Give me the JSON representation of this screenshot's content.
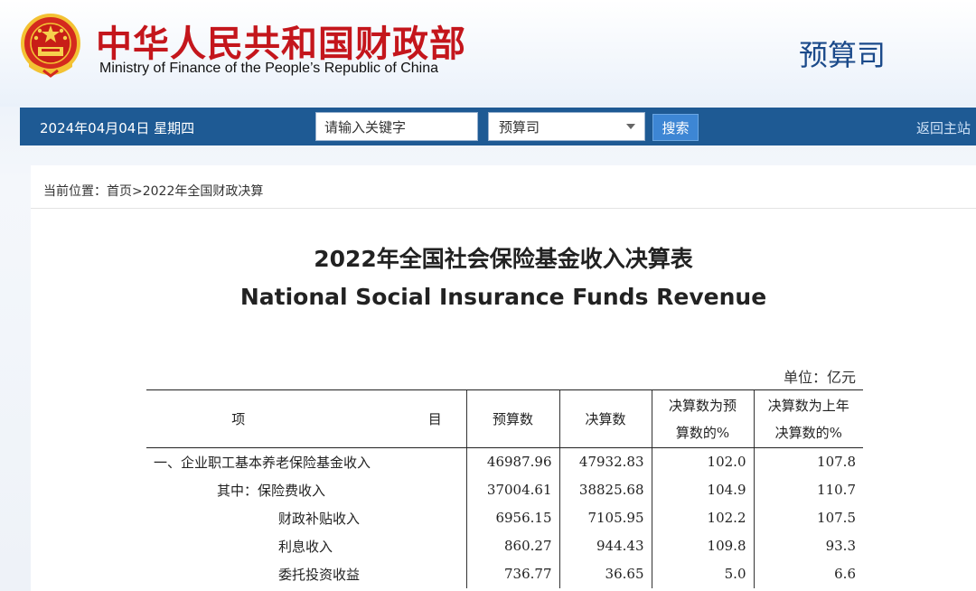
{
  "header": {
    "brand_cn": "中华人民共和国财政部",
    "brand_en": "Ministry of Finance of the People’s Republic of China",
    "department": "预算司"
  },
  "navbar": {
    "date": "2024年04月04日  星期四",
    "search_placeholder": "请输入关键字",
    "scope_selected": "预算司",
    "search_button": "搜索",
    "home_link": "返回主站"
  },
  "breadcrumb": "当前位置：首页>2022年全国财政决算",
  "report": {
    "title_cn": "2022年全国社会保险基金收入决算表",
    "title_en": "National Social Insurance Funds Revenue",
    "unit": "单位：亿元",
    "columns": {
      "item_a": "项",
      "item_b": "目",
      "budget": "预算数",
      "final": "决算数",
      "pct_budget_1": "决算数为预",
      "pct_budget_2": "算数的%",
      "pct_prev_1": "决算数为上年",
      "pct_prev_2": "决算数的%"
    },
    "rows": [
      {
        "item": "一、企业职工基本养老保险基金收入",
        "budget": "46987.96",
        "final": "47932.83",
        "pct_budget": "102.0",
        "pct_prev": "107.8"
      },
      {
        "item": "其中：保险费收入",
        "budget": "37004.61",
        "final": "38825.68",
        "pct_budget": "104.9",
        "pct_prev": "110.7"
      },
      {
        "item": "财政补贴收入",
        "budget": "6956.15",
        "final": "7105.95",
        "pct_budget": "102.2",
        "pct_prev": "107.5"
      },
      {
        "item": "利息收入",
        "budget": "860.27",
        "final": "944.43",
        "pct_budget": "109.8",
        "pct_prev": "93.3"
      },
      {
        "item": "委托投资收益",
        "budget": "736.77",
        "final": "36.65",
        "pct_budget": "5.0",
        "pct_prev": "6.6"
      }
    ]
  }
}
